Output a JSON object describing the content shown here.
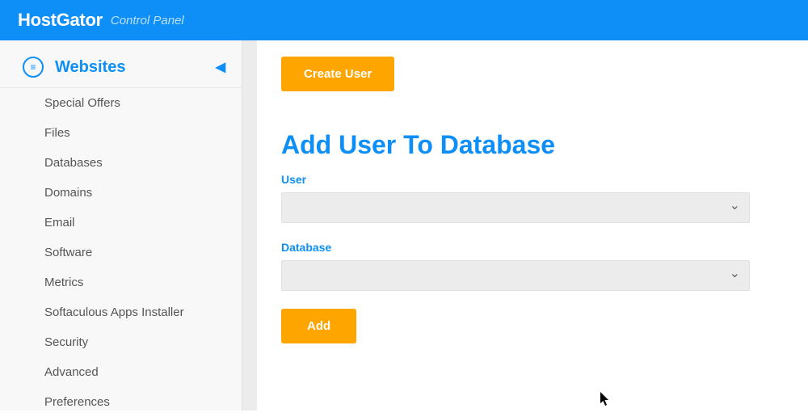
{
  "header": {
    "brand": "HostGator",
    "sub": "Control Panel"
  },
  "sidebar": {
    "active_label": "Websites",
    "items": [
      {
        "label": "Special Offers"
      },
      {
        "label": "Files"
      },
      {
        "label": "Databases"
      },
      {
        "label": "Domains"
      },
      {
        "label": "Email"
      },
      {
        "label": "Software"
      },
      {
        "label": "Metrics"
      },
      {
        "label": "Softaculous Apps Installer"
      },
      {
        "label": "Security"
      },
      {
        "label": "Advanced"
      },
      {
        "label": "Preferences"
      }
    ]
  },
  "main": {
    "create_user_btn": "Create User",
    "section_title": "Add User To Database",
    "user_label": "User",
    "user_value": "",
    "database_label": "Database",
    "database_value": "",
    "add_btn": "Add"
  }
}
